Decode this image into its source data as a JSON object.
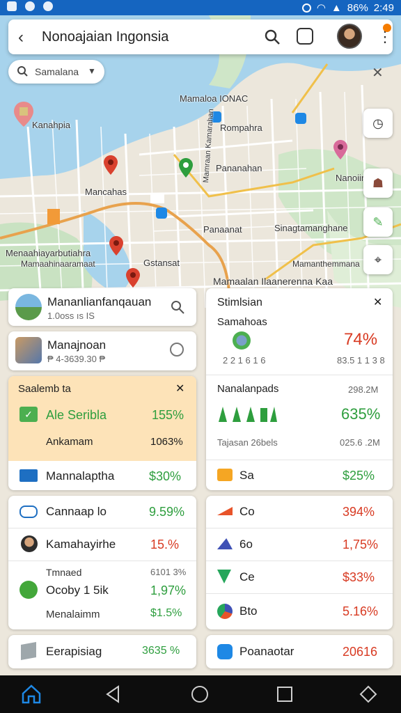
{
  "status": {
    "battery": "86%",
    "time": "2:49"
  },
  "topbar": {
    "title": "Nonoajaian Ingonsia"
  },
  "filter_chip": {
    "label": "Samalana"
  },
  "map_labels": {
    "l1": "Kanahpia",
    "l2": "Mamaloa IONAC",
    "l3": "Rompahra",
    "l4": "Nanoiin",
    "l5": "Pananahan",
    "l6": "Mancahas",
    "l7": "Mamraan Kamarahan",
    "l8": "Panaanat",
    "l9": "Gstansat",
    "l10": "Sinagtamanghane",
    "l11": "Menaahiayarbutiahra",
    "l12": "Mamaahinaaramaat",
    "l13": "Mamaalan Ilaanerenna Kaa",
    "l14": "Mamanthemmana"
  },
  "left_panel": {
    "card1": {
      "title": "Mananlianfanqauan",
      "sub": "1.0oss ıs IS"
    },
    "card2": {
      "title": "Manajnoan",
      "sub": "₱ 4-3639.30 ₱"
    },
    "highlight": {
      "header": "Saalemb ta",
      "row1_label": "Ale Seribla",
      "row1_value": "155%",
      "row2_label": "Ankamam",
      "row2_value": "1063%"
    },
    "row3": {
      "label": "Mannalaptha",
      "value": "$30%"
    },
    "row4": {
      "label": "Cannaap lo",
      "value": "9.59%"
    },
    "row5": {
      "label": "Kamahayirhe",
      "value": "15.%"
    },
    "group6": {
      "label_a": "Tmnaed",
      "value_a": "6101 3%",
      "label_b": "Ocoby 1 5ik",
      "value_b": "1,97%",
      "label_c": "Menalaimm",
      "value_c": "$1.5%"
    },
    "row7": {
      "label": "Eerapisiag",
      "value": "3635 %"
    }
  },
  "right_panel": {
    "header": "Stimlsian",
    "sub_header": "Samahoas",
    "main_value": "74%",
    "main_left_small": "2 2 1 6 1 6",
    "main_right_small": "83.5 1 1 3 8",
    "section2": {
      "title": "Nanalanpads",
      "title_value": "298.2M",
      "value": "635%",
      "footer_label": "Tajasan 26bels",
      "footer_value": "025.6 .2M"
    },
    "rows": [
      {
        "label": "Sa",
        "value": "$25%",
        "color": "#2e9e3e"
      },
      {
        "label": "Co",
        "value": "394%",
        "color": "#d83a22"
      },
      {
        "label": "6o",
        "value": "1,75%",
        "color": "#d83a22"
      },
      {
        "label": "Ce",
        "value": "$33%",
        "color": "#d83a22"
      },
      {
        "label": "Bto",
        "value": "5.16%",
        "color": "#d83a22"
      }
    ],
    "last": {
      "label": "Poanaotar",
      "value": "20616"
    }
  },
  "colors": {
    "accent": "#1565c0",
    "positive": "#2e9e3e",
    "negative": "#d83a22",
    "highlight_bg": "#fde3b8"
  }
}
